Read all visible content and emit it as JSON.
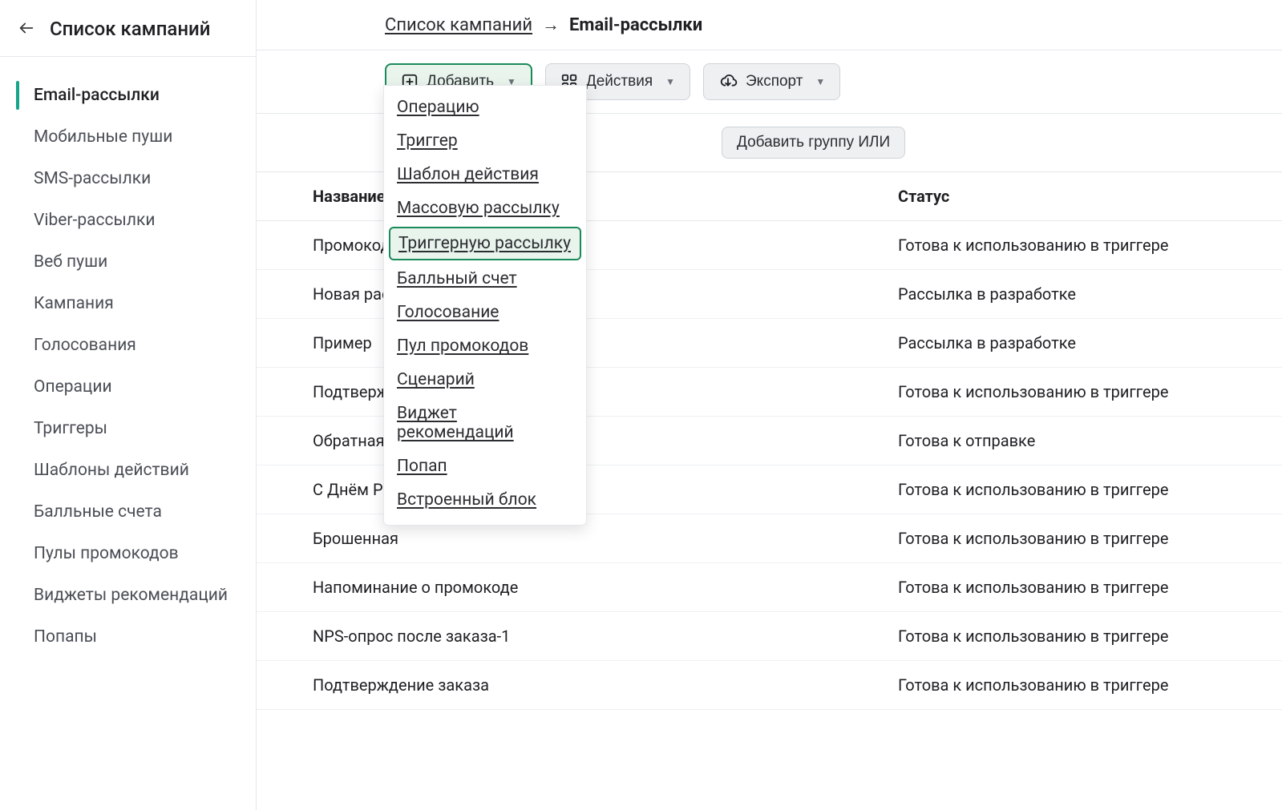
{
  "sidebar": {
    "title": "Список кампаний",
    "items": [
      {
        "label": "Email-рассылки",
        "active": true
      },
      {
        "label": "Мобильные пуши",
        "active": false
      },
      {
        "label": "SMS-рассылки",
        "active": false
      },
      {
        "label": "Viber-рассылки",
        "active": false
      },
      {
        "label": "Веб пуши",
        "active": false
      },
      {
        "label": "Кампания",
        "active": false
      },
      {
        "label": "Голосования",
        "active": false
      },
      {
        "label": "Операции",
        "active": false
      },
      {
        "label": "Триггеры",
        "active": false
      },
      {
        "label": "Шаблоны действий",
        "active": false
      },
      {
        "label": "Балльные счета",
        "active": false
      },
      {
        "label": "Пулы промокодов",
        "active": false
      },
      {
        "label": "Виджеты рекомендаций",
        "active": false
      },
      {
        "label": "Попапы",
        "active": false
      }
    ]
  },
  "breadcrumb": {
    "link": "Список кампаний",
    "current": "Email-рассылки"
  },
  "toolbar": {
    "add_label": "Добавить",
    "actions_label": "Действия",
    "export_label": "Экспорт"
  },
  "filters": {
    "add_or_group": "Добавить группу ИЛИ"
  },
  "dropdown": {
    "items": [
      {
        "label": "Операцию",
        "highlighted": false
      },
      {
        "label": "Триггер",
        "highlighted": false
      },
      {
        "label": "Шаблон действия",
        "highlighted": false
      },
      {
        "label": "Массовую рассылку",
        "highlighted": false
      },
      {
        "label": "Триггерную рассылку",
        "highlighted": true
      },
      {
        "label": "Балльный счет",
        "highlighted": false
      },
      {
        "label": "Голосование",
        "highlighted": false
      },
      {
        "label": "Пул промокодов",
        "highlighted": false
      },
      {
        "label": "Сценарий",
        "highlighted": false
      },
      {
        "label": "Виджет рекомендаций",
        "highlighted": false
      },
      {
        "label": "Попап",
        "highlighted": false
      },
      {
        "label": "Встроенный блок",
        "highlighted": false
      }
    ]
  },
  "table": {
    "columns": {
      "name": "Название р",
      "status": "Статус"
    },
    "rows": [
      {
        "name": "Промокод",
        "status": "Готова к использованию в триггере"
      },
      {
        "name": "Новая расс",
        "status": "Рассылка в разработке"
      },
      {
        "name": "Пример",
        "status": "Рассылка в разработке"
      },
      {
        "name": "Подтвержд",
        "status": "Готова к использованию в триггере"
      },
      {
        "name": "Обратная с",
        "status": "Готова к отправке"
      },
      {
        "name": "С Днём Рож",
        "status": "Готова к использованию в триггере"
      },
      {
        "name": "Брошенная",
        "status": "Готова к использованию в триггере"
      },
      {
        "name": "Напоминание о промокоде",
        "status": "Готова к использованию в триггере"
      },
      {
        "name": "NPS-опрос после заказа-1",
        "status": "Готова к использованию в триггере"
      },
      {
        "name": "Подтверждение заказа",
        "status": "Готова к использованию в триггере"
      }
    ]
  }
}
